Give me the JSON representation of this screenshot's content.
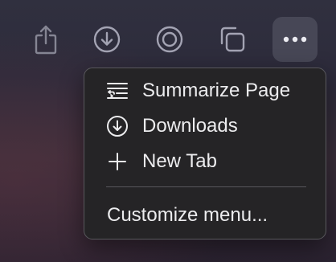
{
  "toolbar": {
    "buttons": [
      {
        "icon": "share-icon"
      },
      {
        "icon": "download-icon"
      },
      {
        "icon": "reader-icon"
      },
      {
        "icon": "tabs-overview-icon"
      },
      {
        "icon": "more-icon"
      }
    ]
  },
  "menu": {
    "items": [
      {
        "label": "Summarize Page",
        "icon": "summarize-icon"
      },
      {
        "label": "Downloads",
        "icon": "download-circle-icon"
      },
      {
        "label": "New Tab",
        "icon": "plus-icon"
      }
    ],
    "customize_label": "Customize menu..."
  },
  "colors": {
    "menu_background": "#252426",
    "menu_text": "#ececee",
    "toolbar_icon": "#9c9cac",
    "active_button_bg": "#474756"
  }
}
